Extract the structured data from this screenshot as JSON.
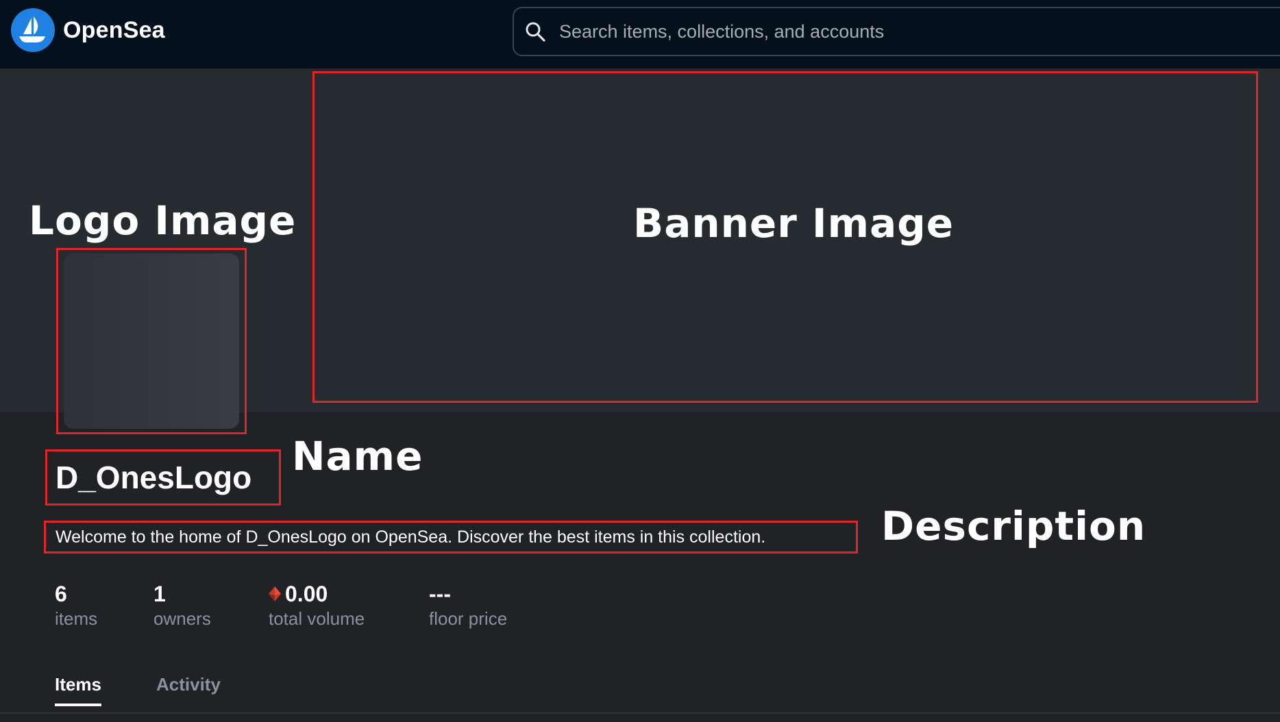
{
  "header": {
    "brand_name": "OpenSea",
    "brand_icon": "opensea-ship-icon",
    "search": {
      "placeholder": "Search items, collections, and accounts",
      "icon": "search-icon"
    }
  },
  "annotations": {
    "banner": "Banner Image",
    "logo": "Logo Image",
    "name": "Name",
    "description": "Description"
  },
  "collection": {
    "name": "D_OnesLogo",
    "description": "Welcome to the home of D_OnesLogo on OpenSea. Discover the best items in this collection."
  },
  "stats": [
    {
      "value": "6",
      "label": "items"
    },
    {
      "value": "1",
      "label": "owners"
    },
    {
      "value": "0.00",
      "label": "total volume",
      "icon": "eth-icon"
    },
    {
      "value": "---",
      "label": "floor price"
    }
  ],
  "tabs": [
    {
      "label": "Items",
      "active": true
    },
    {
      "label": "Activity",
      "active": false
    }
  ],
  "colors": {
    "header_bg": "#04111d",
    "hero_bg": "#262b2f",
    "page_bg": "#202225",
    "annotation_box": "#e3242b",
    "brand_blue": "#2081e2"
  }
}
